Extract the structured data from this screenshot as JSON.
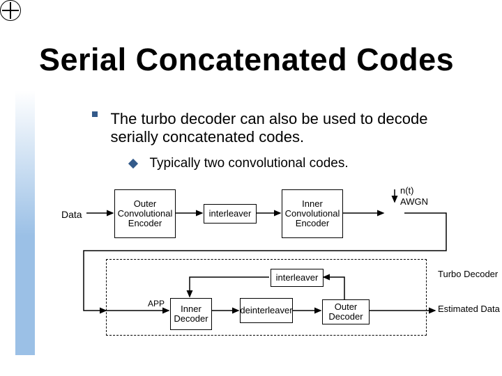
{
  "title": "Serial Concatenated Codes",
  "bullets": {
    "main": "The turbo decoder can also be used to decode serially concatenated codes.",
    "sub": "Typically two convolutional codes."
  },
  "encoder": {
    "input": "Data",
    "outer": "Outer Convolutional Encoder",
    "interleaver": "interleaver",
    "inner": "Inner Convolutional Encoder",
    "noise_top": "n(t)",
    "noise_bot": "AWGN"
  },
  "decoder": {
    "interleaver": "interleaver",
    "app": "APP",
    "inner": "Inner Decoder",
    "deinterleaver": "deinterleaver",
    "outer": "Outer Decoder",
    "group_label": "Turbo Decoder",
    "output": "Estimated Data"
  }
}
